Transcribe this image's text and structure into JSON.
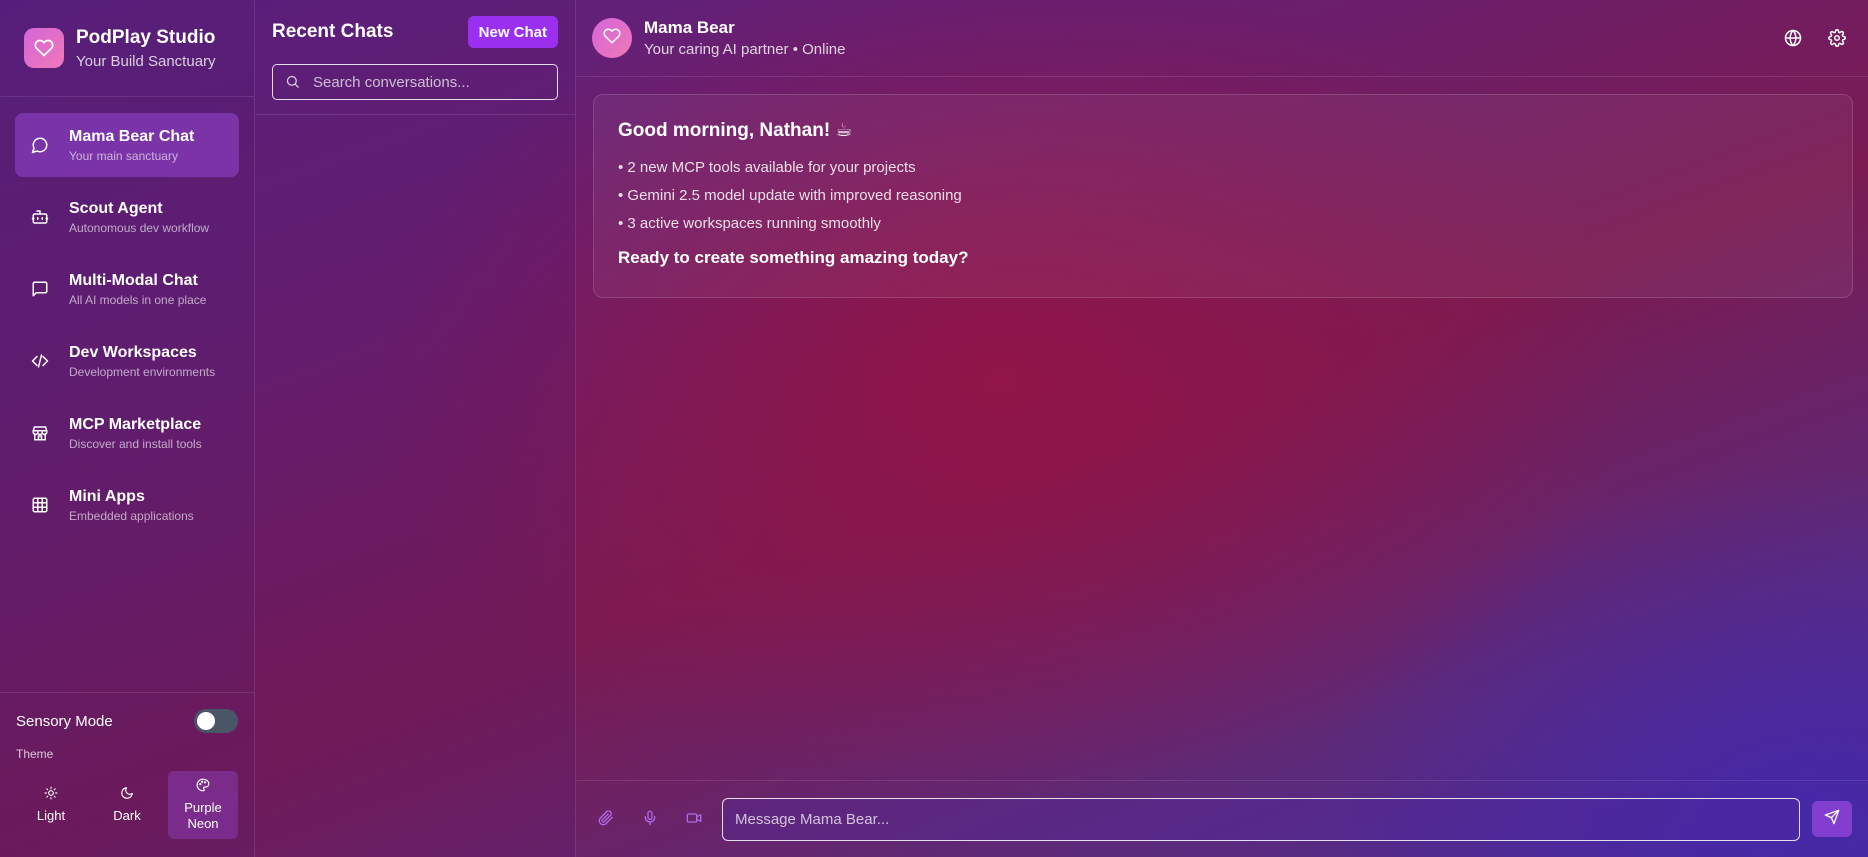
{
  "brand": {
    "title": "PodPlay Studio",
    "subtitle": "Your Build Sanctuary",
    "icon": "heart-icon"
  },
  "sidebar": {
    "items": [
      {
        "label": "Mama Bear Chat",
        "desc": "Your main sanctuary",
        "icon": "chat-bubble-icon",
        "active": true
      },
      {
        "label": "Scout Agent",
        "desc": "Autonomous dev workflow",
        "icon": "bot-icon"
      },
      {
        "label": "Multi-Modal Chat",
        "desc": "All AI models in one place",
        "icon": "message-square-icon"
      },
      {
        "label": "Dev Workspaces",
        "desc": "Development environments",
        "icon": "code-icon"
      },
      {
        "label": "MCP Marketplace",
        "desc": "Discover and install tools",
        "icon": "store-icon"
      },
      {
        "label": "Mini Apps",
        "desc": "Embedded applications",
        "icon": "grid-icon"
      }
    ],
    "sensory_label": "Sensory Mode",
    "sensory_on": false,
    "theme_label": "Theme",
    "themes": [
      {
        "label": "Light",
        "icon": "sun-icon"
      },
      {
        "label": "Dark",
        "icon": "moon-icon"
      },
      {
        "label": "Purple\nNeon",
        "icon": "palette-icon",
        "active": true
      }
    ]
  },
  "chatlist": {
    "title": "Recent Chats",
    "new_chat_label": "New Chat",
    "search_placeholder": "Search conversations..."
  },
  "main": {
    "agent_name": "Mama Bear",
    "agent_status": "Your caring AI partner • Online",
    "greeting": {
      "title": "Good morning, Nathan! ☕",
      "lines": [
        "• 2 new MCP tools available for your projects",
        "• Gemini 2.5 model update with improved reasoning",
        "• 3 active workspaces running smoothly"
      ],
      "cta": "Ready to create something amazing today?"
    },
    "composer_placeholder": "Message Mama Bear..."
  },
  "colors": {
    "accent": "#9b2ff0",
    "pink": "#e06ad0"
  }
}
